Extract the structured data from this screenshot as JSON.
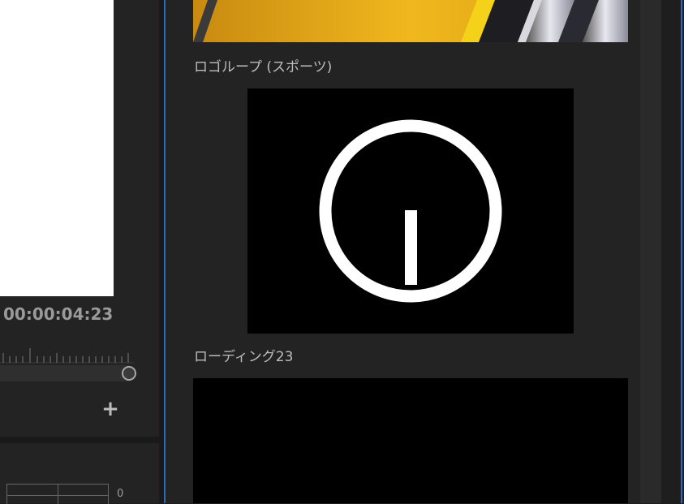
{
  "monitor": {
    "timecode": "00:00:04:23",
    "add_button_label": "+",
    "meter_zero_label": "0"
  },
  "browser": {
    "templates": [
      {
        "label": "ロゴループ (スポーツ)"
      },
      {
        "label": "ローディング23"
      }
    ]
  },
  "colors": {
    "accent_border": "#2d6ab8",
    "panel_bg": "#232323",
    "thumb_gold": "#e0a516"
  }
}
